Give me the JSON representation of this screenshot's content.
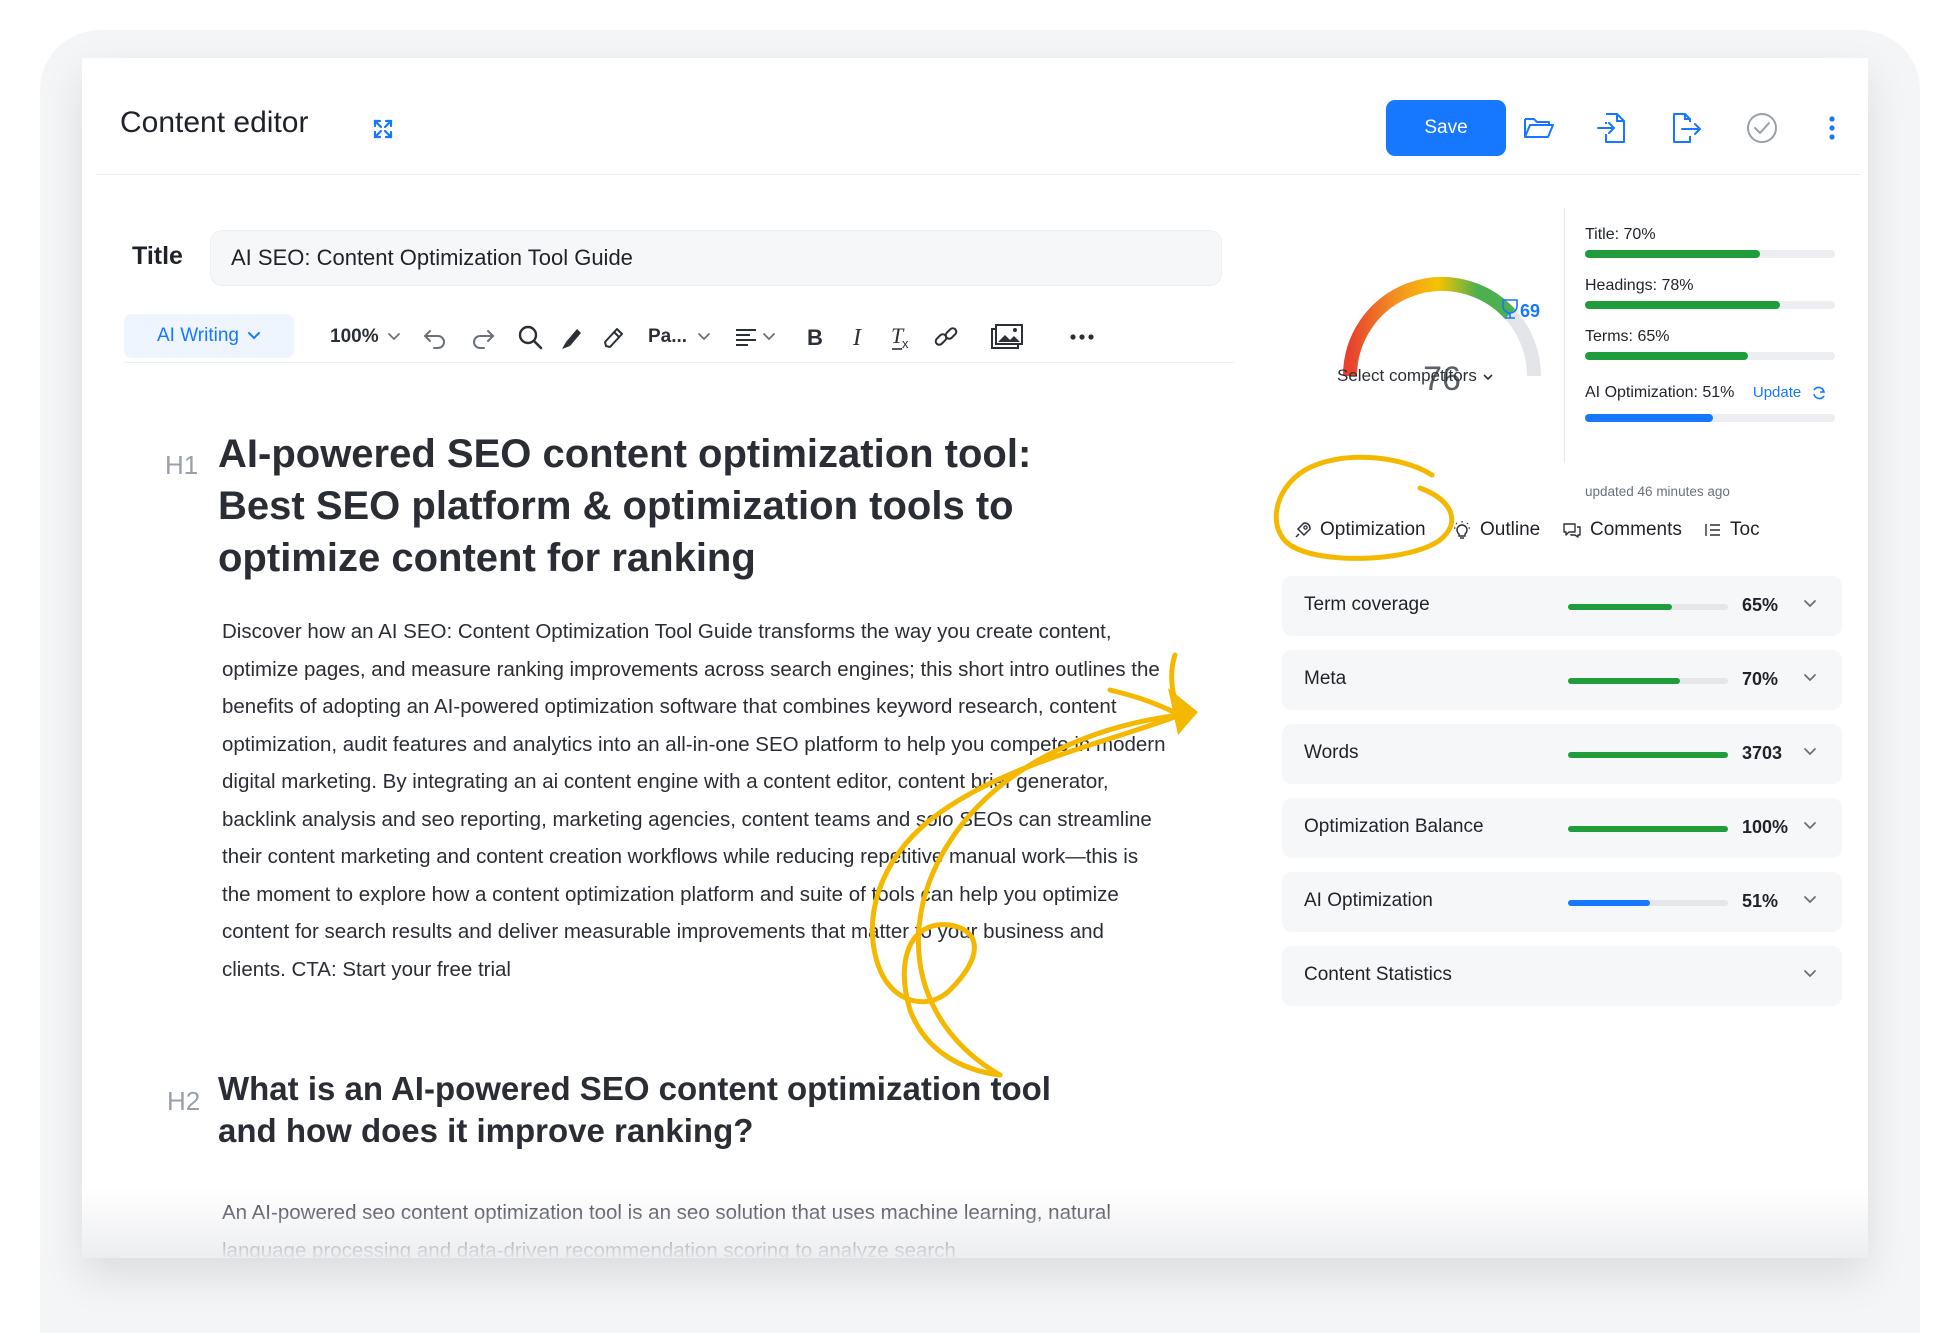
{
  "header": {
    "title": "Content editor",
    "save_label": "Save"
  },
  "title_field": {
    "label": "Title",
    "value": "AI SEO: Content Optimization Tool Guide"
  },
  "toolbar": {
    "ai_writing": "AI Writing",
    "zoom": "100%",
    "paragraph": "Pa..."
  },
  "document": {
    "h1_tag": "H1",
    "h1": "AI-powered SEO content optimization tool: Best SEO platform & optimization tools to optimize content for ranking",
    "intro": "Discover how an AI SEO: Content Optimization Tool Guide transforms the way you create content, optimize pages, and measure ranking improvements across search engines; this short intro outlines the benefits of adopting an AI-powered optimization software that combines keyword research, content optimization, audit features and analytics into an all-in-one SEO platform to help you compete in modern digital marketing. By integrating an ai content engine with a content editor, content brief generator, backlink analysis and seo reporting, marketing agencies, content teams and solo SEOs can streamline their content marketing and content creation workflows while reducing repetitive manual work—this is the moment to explore how a content optimization platform and suite of tools can help you optimize content for search results and deliver measurable improvements that matter to your business and clients. CTA: Start your free trial",
    "h2_tag": "H2",
    "h2": "What is an AI-powered SEO content optimization tool and how does it improve ranking?",
    "para2": "An AI-powered seo content optimization tool is an seo solution that uses machine learning, natural language processing and data-driven recommendation scoring to analyze search"
  },
  "score": {
    "value": "76",
    "trophy": "69",
    "select_competitors": "Select competitors"
  },
  "mini_metrics": [
    {
      "label": "Title: 70%",
      "value": 0.7,
      "color": "#1e9d3a"
    },
    {
      "label": "Headings: 78%",
      "value": 0.78,
      "color": "#1e9d3a"
    },
    {
      "label": "Terms: 65%",
      "value": 0.65,
      "color": "#1e9d3a"
    },
    {
      "label": "AI Optimization: 51%",
      "value": 0.51,
      "color": "#1677ff"
    }
  ],
  "update_label": "Update",
  "updated_ago": "updated 46 minutes ago",
  "tabs": [
    "Optimization",
    "Outline",
    "Comments",
    "Toc"
  ],
  "metrics": [
    {
      "label": "Term coverage",
      "value": "65%",
      "fill": 0.65,
      "color": "#1e9d3a"
    },
    {
      "label": "Meta",
      "value": "70%",
      "fill": 0.7,
      "color": "#1e9d3a"
    },
    {
      "label": "Words",
      "value": "3703",
      "fill": 1.0,
      "color": "#1e9d3a"
    },
    {
      "label": "Optimization Balance",
      "value": "100%",
      "fill": 1.0,
      "color": "#1e9d3a"
    },
    {
      "label": "AI Optimization",
      "value": "51%",
      "fill": 0.51,
      "color": "#1677ff"
    },
    {
      "label": "Content Statistics",
      "value": "",
      "fill": null,
      "color": ""
    }
  ],
  "colors": {
    "accent": "#1677ff",
    "good": "#1e9d3a",
    "highlight": "#f5b800"
  }
}
